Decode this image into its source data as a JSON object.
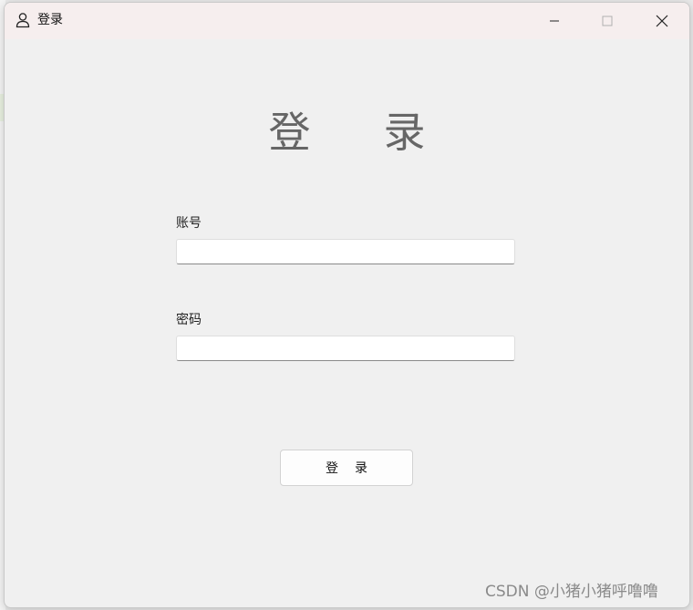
{
  "window": {
    "title": "登录",
    "controls": {
      "minimize_icon": "minimize-icon",
      "maximize_icon": "maximize-icon",
      "close_icon": "close-icon"
    },
    "title_icon": "user-icon"
  },
  "form": {
    "heading": "登录",
    "account_label": "账号",
    "account_value": "",
    "password_label": "密码",
    "password_value": "",
    "login_button_label": "登录"
  },
  "watermark": "CSDN @小猪小猪呼噜噜",
  "colors": {
    "titlebar": "#f6eeee",
    "window_bg": "#f0f0f0",
    "heading_text": "#666666",
    "watermark_text": "#8a8a8a"
  }
}
